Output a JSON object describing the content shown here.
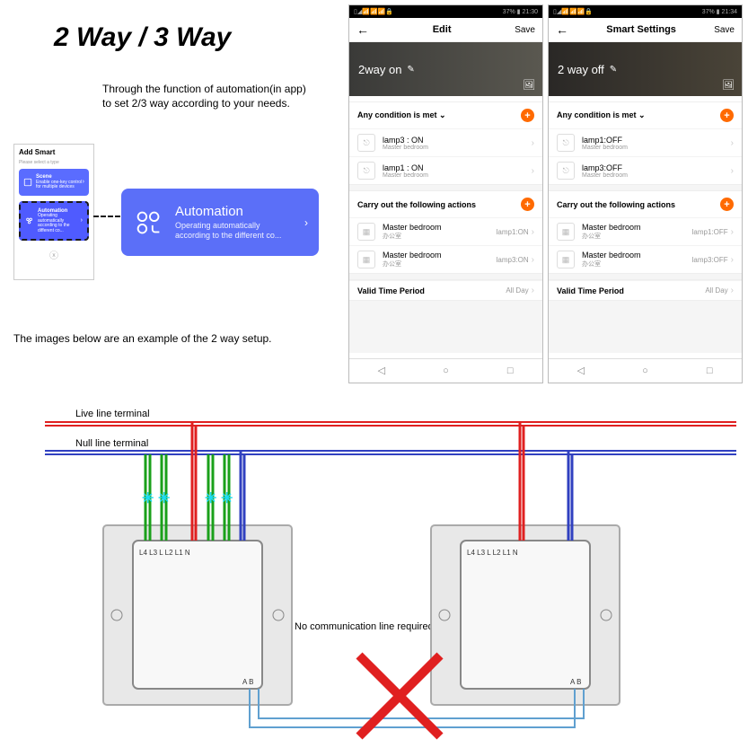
{
  "title": "2 Way / 3 Way",
  "desc1": "Through the function of automation(in app)\nto set 2/3 way according to your needs.",
  "desc2": "The images below are an example of the 2 way setup.",
  "mini": {
    "header": "Add Smart",
    "sub": "Please select a type",
    "scene": "Scene",
    "scene_sub": "Enable one-key control for multiple devices",
    "auto": "Automation",
    "auto_sub": "Operating automatically according to the different co..."
  },
  "autoCard": {
    "title": "Automation",
    "sub": "Operating automatically\naccording to the different co..."
  },
  "phone1": {
    "status_left": "▯◢📶📶📶🔒",
    "status_right": "37% ▮ 21:30",
    "navTitle": "Edit",
    "save": "Save",
    "heroName": "2way on",
    "condHeader": "Any condition is met",
    "conds": [
      {
        "main": "lamp3 : ON",
        "sub": "Master bedroom"
      },
      {
        "main": "lamp1 : ON",
        "sub": "Master bedroom"
      }
    ],
    "actHeader": "Carry out the following actions",
    "acts": [
      {
        "main": "Master bedroom",
        "sub": "办公室",
        "right": "lamp1:ON"
      },
      {
        "main": "Master bedroom",
        "sub": "办公室",
        "right": "lamp3:ON"
      }
    ],
    "validLabel": "Valid Time Period",
    "validVal": "All Day"
  },
  "phone2": {
    "status_left": "▯◢📶📶📶🔒",
    "status_right": "37% ▮ 21:34",
    "navTitle": "Smart Settings",
    "save": "Save",
    "heroName": "2 way off",
    "condHeader": "Any condition is met",
    "conds": [
      {
        "main": "lamp1:OFF",
        "sub": "Master bedroom"
      },
      {
        "main": "lamp3:OFF",
        "sub": "Master bedroom"
      }
    ],
    "actHeader": "Carry out the following actions",
    "acts": [
      {
        "main": "Master bedroom",
        "sub": "办公室",
        "right": "lamp1:OFF"
      },
      {
        "main": "Master bedroom",
        "sub": "办公室",
        "right": "lamp3:OFF"
      }
    ],
    "validLabel": "Valid Time Period",
    "validVal": "All Day"
  },
  "diagram": {
    "live": "Live line terminal",
    "null": "Null line terminal",
    "terminals": "L4 L3 L L2 L1 N",
    "ab": "A B",
    "noComm": "No communication line required"
  }
}
